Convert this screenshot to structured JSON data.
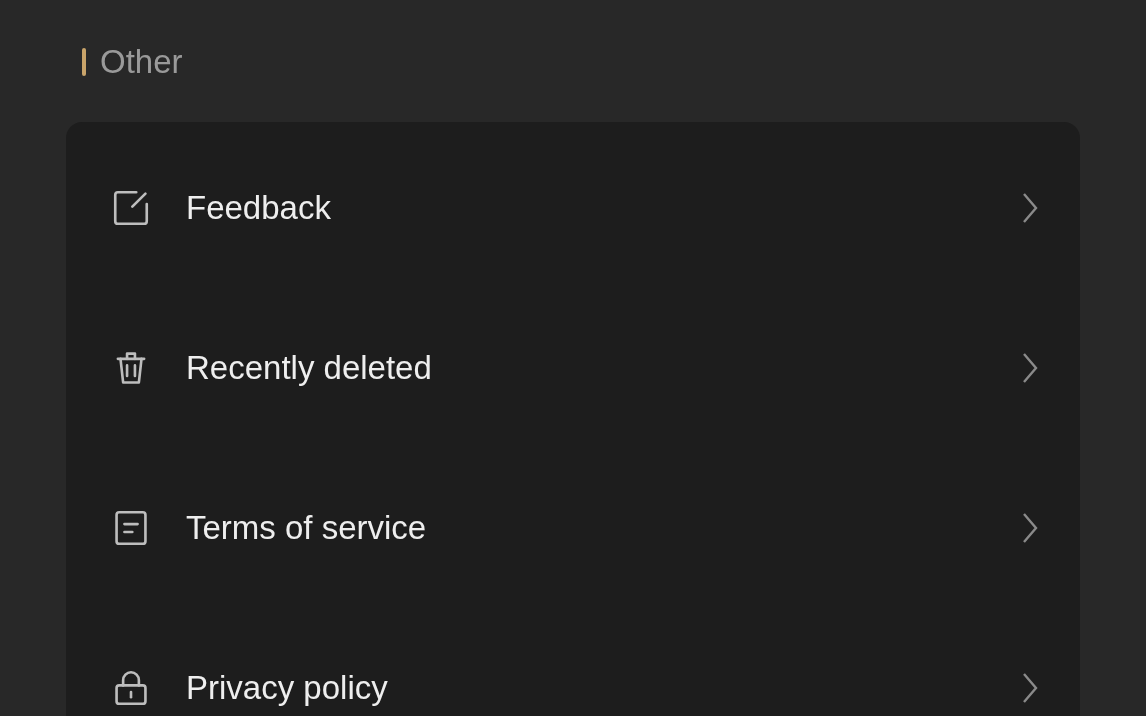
{
  "section": {
    "title": "Other"
  },
  "items": [
    {
      "label": "Feedback"
    },
    {
      "label": "Recently deleted"
    },
    {
      "label": "Terms of service"
    },
    {
      "label": "Privacy policy"
    }
  ]
}
